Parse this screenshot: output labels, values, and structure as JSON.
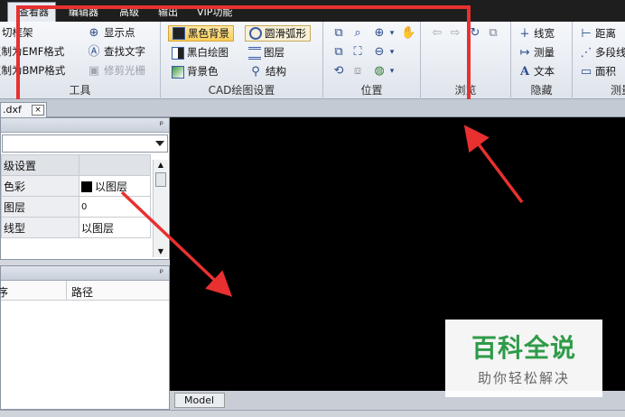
{
  "tabs": [
    "查看器",
    "编辑器",
    "高级",
    "输出",
    "VIP功能"
  ],
  "ribbon": {
    "tools": {
      "label": "工具",
      "items": [
        "切框架",
        "复制为EMF格式",
        "复制为BMP格式",
        "显示点",
        "查找文字",
        "修剪光栅"
      ]
    },
    "cad_settings": {
      "label": "CAD绘图设置",
      "items": [
        "黑色背景",
        "黑白绘图",
        "背景色",
        "圆滑弧形",
        "图层",
        "结构"
      ]
    },
    "position": {
      "label": "位置"
    },
    "browse": {
      "label": "浏览"
    },
    "hide": {
      "label": "隐藏",
      "items": [
        "线宽",
        "测量",
        "文本"
      ]
    },
    "measure": {
      "label": "测量",
      "items": [
        "距离",
        "多段线",
        "面积"
      ]
    }
  },
  "file_tab": {
    "name": ".dxf",
    "close": "×"
  },
  "properties_panel": {
    "pin": "ᵖ",
    "rows": [
      {
        "name": "级设置",
        "value": ""
      },
      {
        "name": "色彩",
        "value": "以图层"
      },
      {
        "name": "图层",
        "value": "0"
      },
      {
        "name": "线型",
        "value": "以图层"
      }
    ]
  },
  "files_panel": {
    "pin": "ᵖ",
    "col1": "序",
    "col2": "路径"
  },
  "model_tab": "Model",
  "watermark": {
    "line1": "百科全说",
    "line2": "助你轻松解决"
  }
}
